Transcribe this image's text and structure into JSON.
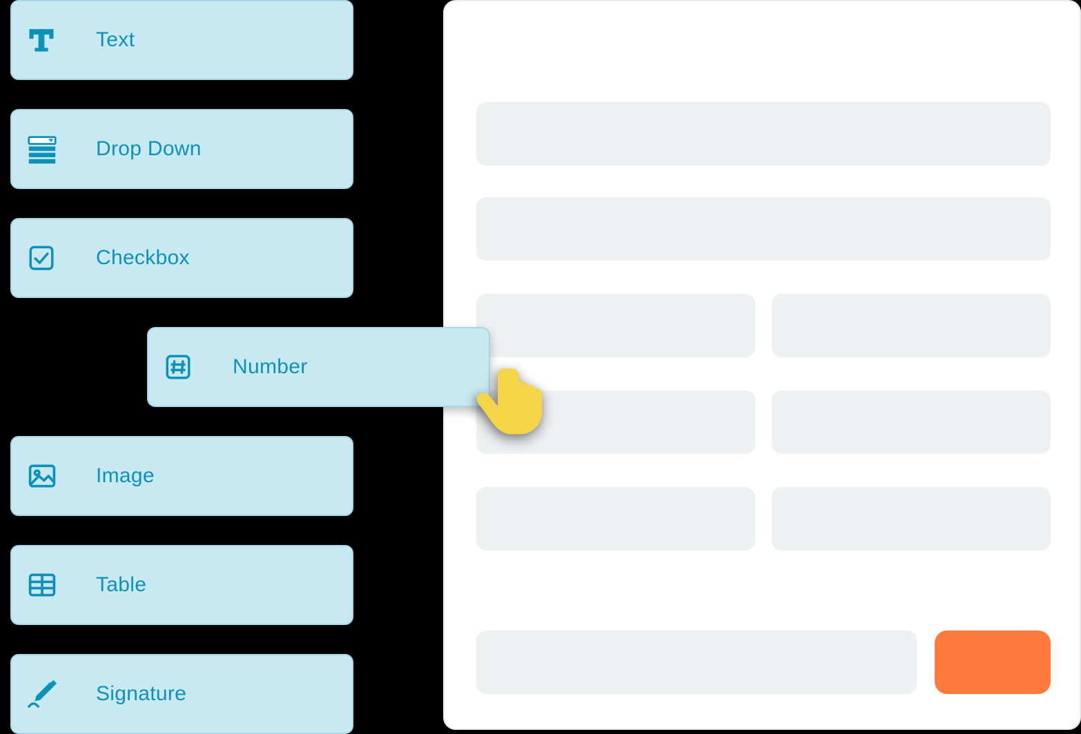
{
  "palette": {
    "items": [
      {
        "id": "text",
        "label": "Text",
        "icon": "letter-t-icon"
      },
      {
        "id": "dropdown",
        "label": "Drop Down",
        "icon": "dropdown-icon"
      },
      {
        "id": "checkbox",
        "label": "Checkbox",
        "icon": "checkbox-icon"
      },
      {
        "id": "number",
        "label": "Number",
        "icon": "hash-icon",
        "state": "dragging"
      },
      {
        "id": "image",
        "label": "Image",
        "icon": "image-icon"
      },
      {
        "id": "table",
        "label": "Table",
        "icon": "table-icon"
      },
      {
        "id": "signature",
        "label": "Signature",
        "icon": "signature-icon"
      }
    ]
  },
  "colors": {
    "palette_item_bg": "#c9e9f2",
    "palette_item_border": "#a8d8e8",
    "icon_and_text": "#0e91b8",
    "canvas_bg": "#ffffff",
    "placeholder_bg": "#eef0f1",
    "primary_button_bg": "#ff7a3d",
    "cursor_hand_fill": "#f5d547"
  },
  "canvas": {
    "placeholders": [
      {
        "type": "full"
      },
      {
        "type": "full"
      },
      {
        "type": "half-pair"
      },
      {
        "type": "half-pair"
      },
      {
        "type": "half-pair"
      },
      {
        "type": "footer-with-button"
      }
    ]
  }
}
